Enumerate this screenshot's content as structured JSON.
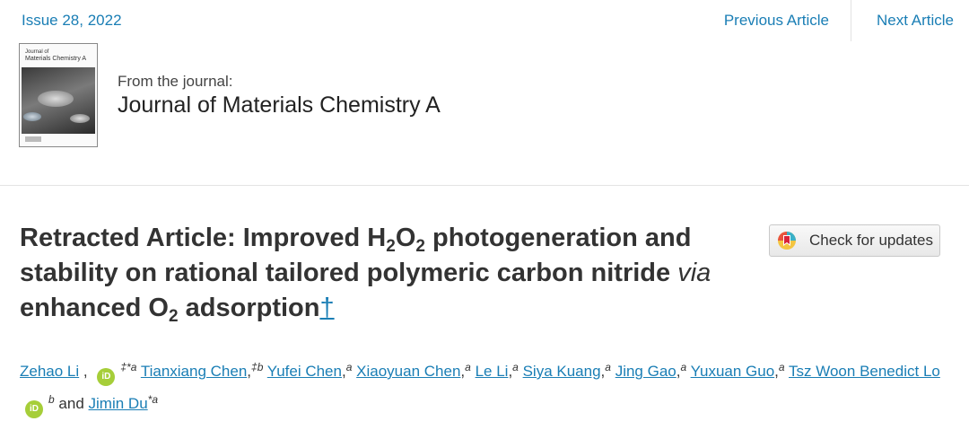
{
  "header": {
    "issue": "Issue 28, 2022",
    "previous": "Previous Article",
    "next": "Next Article"
  },
  "journal": {
    "cover_title_line1": "Journal of",
    "cover_title_line2": "Materials Chemistry A",
    "from_label": "From the journal:",
    "name": "Journal of Materials Chemistry A"
  },
  "article": {
    "title_part1": "Retracted Article: Improved H",
    "title_sub1": "2",
    "title_part2": "O",
    "title_sub2": "2",
    "title_part3": " photogeneration and stability on rational tailored polymeric carbon nitride ",
    "title_italic": "via",
    "title_part4": " enhanced O",
    "title_sub3": "2",
    "title_part5": " adsorption",
    "title_dagger": "†",
    "check_updates": "Check for updates"
  },
  "authors": {
    "orcid_label": "iD",
    "and": "and",
    "list": [
      {
        "name": "Zehao Li",
        "sup": "‡*a"
      },
      {
        "name": "Tianxiang Chen",
        "sup": "‡b"
      },
      {
        "name": "Yufei Chen",
        "sup": "a"
      },
      {
        "name": "Xiaoyuan Chen",
        "sup": "a"
      },
      {
        "name": "Le Li",
        "sup": "a"
      },
      {
        "name": "Siya Kuang",
        "sup": "a"
      },
      {
        "name": "Jing Gao",
        "sup": "a"
      },
      {
        "name": "Yuxuan Guo",
        "sup": "a"
      },
      {
        "name": "Tsz Woon Benedict Lo",
        "sup": "b"
      },
      {
        "name": "Jimin Du",
        "sup": "*a"
      }
    ]
  },
  "colors": {
    "link": "#1a7eb5",
    "orcid": "#a6ce39"
  }
}
